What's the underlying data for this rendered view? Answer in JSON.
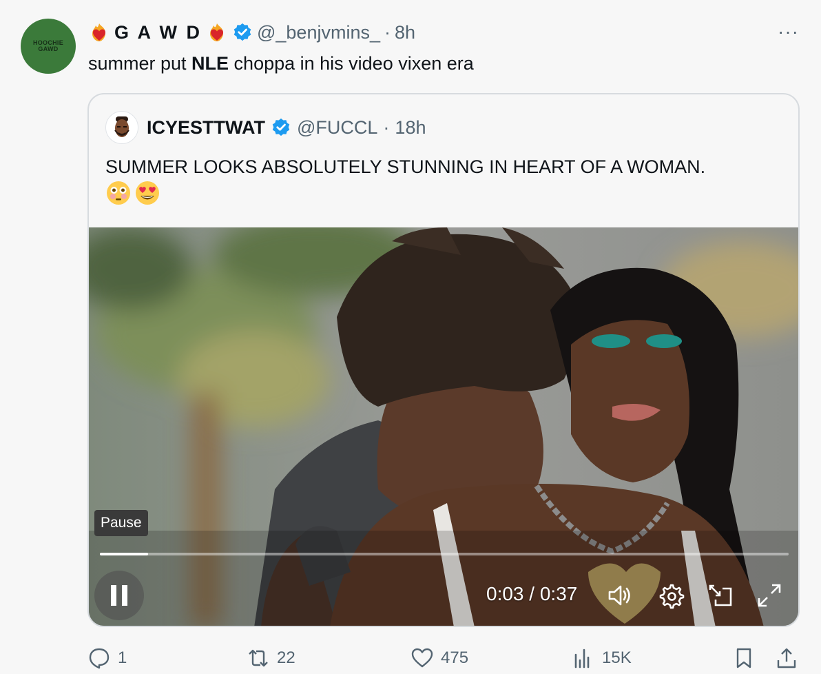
{
  "author": {
    "avatar_text_line1": "HOOCHIE",
    "avatar_text_line2": "GAWD",
    "display_name": "G A W D",
    "handle": "@_benjvmins_",
    "separator": "·",
    "time": "8h",
    "verified": true,
    "more_label": "···"
  },
  "tweet": {
    "text_before": "summer put ",
    "text_bold": "NLE",
    "text_after": " choppa in his video vixen era"
  },
  "quote": {
    "display_name": "ICYESTTWAT",
    "handle": "@FUCCL",
    "separator": "·",
    "time": "18h",
    "verified": true,
    "text": "SUMMER LOOKS ABSOLUTELY STUNNING IN HEART OF A WOMAN.",
    "emojis": [
      "flushed-face",
      "smiling-face-with-heart-eyes"
    ]
  },
  "video": {
    "tooltip": "Pause",
    "current_time": "0:03",
    "duration": "0:37",
    "time_separator": "/",
    "progress": 0.07
  },
  "actions": {
    "replies": "1",
    "reposts": "22",
    "likes": "475",
    "views": "15K"
  },
  "colors": {
    "verified_blue": "#1d9bf0",
    "secondary_text": "#536471",
    "avatar_green": "#3b7a3a"
  }
}
